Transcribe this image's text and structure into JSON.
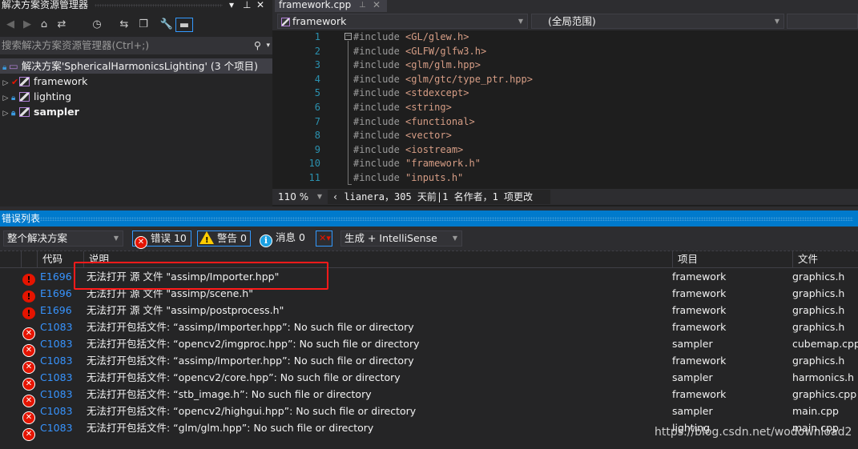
{
  "solution_explorer": {
    "title": "解决方案资源管理器",
    "search_placeholder": "搜索解决方案资源管理器(Ctrl+;)",
    "solution": "解决方案'SphericalHarmonicsLighting' (3 个项目)",
    "projects": [
      {
        "name": "framework",
        "status": "checked-out"
      },
      {
        "name": "lighting",
        "status": "locked"
      },
      {
        "name": "sampler",
        "status": "locked",
        "bold": true
      }
    ]
  },
  "editor": {
    "tab": "framework.cpp",
    "project_dropdown": "framework",
    "scope_dropdown": "(全局范围)",
    "lines": [
      {
        "n": "1",
        "kw": "#include ",
        "inc": "<GL/glew.h>"
      },
      {
        "n": "2",
        "kw": "#include ",
        "inc": "<GLFW/glfw3.h>"
      },
      {
        "n": "3",
        "kw": "#include ",
        "inc": "<glm/glm.hpp>"
      },
      {
        "n": "4",
        "kw": "#include ",
        "inc": "<glm/gtc/type_ptr.hpp>"
      },
      {
        "n": "5",
        "kw": "#include ",
        "inc": "<stdexcept>"
      },
      {
        "n": "6",
        "kw": "#include ",
        "inc": "<string>"
      },
      {
        "n": "7",
        "kw": "#include ",
        "inc": "<functional>"
      },
      {
        "n": "8",
        "kw": "#include ",
        "inc": "<vector>"
      },
      {
        "n": "9",
        "kw": "#include ",
        "inc": "<iostream>"
      },
      {
        "n": "10",
        "kw": "#include ",
        "inc": "\"framework.h\""
      },
      {
        "n": "11",
        "kw": "#include ",
        "inc": "\"inputs.h\""
      }
    ],
    "zoom": "110 %",
    "codelens": "‹ lianera，305 天前|1 名作者，1 项更改"
  },
  "error_list": {
    "title": "错误列表",
    "scope": "整个解决方案",
    "errors_label": "错误 10",
    "warnings_label": "警告 0",
    "messages_label": "消息 0",
    "source": "生成 + IntelliSense",
    "columns": {
      "code": "代码",
      "description": "说明",
      "project": "项目",
      "file": "文件"
    },
    "rows": [
      {
        "type": "intellisense",
        "code": "E1696",
        "description": "无法打开 源 文件 \"assimp/Importer.hpp\"",
        "project": "framework",
        "file": "graphics.h"
      },
      {
        "type": "intellisense",
        "code": "E1696",
        "description": "无法打开 源 文件 \"assimp/scene.h\"",
        "project": "framework",
        "file": "graphics.h"
      },
      {
        "type": "intellisense",
        "code": "E1696",
        "description": "无法打开 源 文件 \"assimp/postprocess.h\"",
        "project": "framework",
        "file": "graphics.h"
      },
      {
        "type": "error",
        "code": "C1083",
        "description": "无法打开包括文件: “assimp/Importer.hpp”: No such file or directory",
        "project": "framework",
        "file": "graphics.h"
      },
      {
        "type": "error",
        "code": "C1083",
        "description": "无法打开包括文件: “opencv2/imgproc.hpp”: No such file or directory",
        "project": "sampler",
        "file": "cubemap.cpp"
      },
      {
        "type": "error",
        "code": "C1083",
        "description": "无法打开包括文件: “assimp/Importer.hpp”: No such file or directory",
        "project": "framework",
        "file": "graphics.h"
      },
      {
        "type": "error",
        "code": "C1083",
        "description": "无法打开包括文件: “opencv2/core.hpp”: No such file or directory",
        "project": "sampler",
        "file": "harmonics.h"
      },
      {
        "type": "error",
        "code": "C1083",
        "description": "无法打开包括文件: “stb_image.h”: No such file or directory",
        "project": "framework",
        "file": "graphics.cpp"
      },
      {
        "type": "error",
        "code": "C1083",
        "description": "无法打开包括文件: “opencv2/highgui.hpp”: No such file or directory",
        "project": "sampler",
        "file": "main.cpp"
      },
      {
        "type": "error",
        "code": "C1083",
        "description": "无法打开包括文件: “glm/glm.hpp”: No such file or directory",
        "project": "lighting",
        "file": "main.cpp"
      }
    ]
  },
  "watermark": "https://blog.csdn.net/wodownload2",
  "colors": {
    "accent": "#007acc",
    "error": "#e51400",
    "code_link": "#3794ff",
    "highlight_box": "#ff1a1a",
    "include_string": "#d69d85",
    "line_number": "#2b91af"
  }
}
